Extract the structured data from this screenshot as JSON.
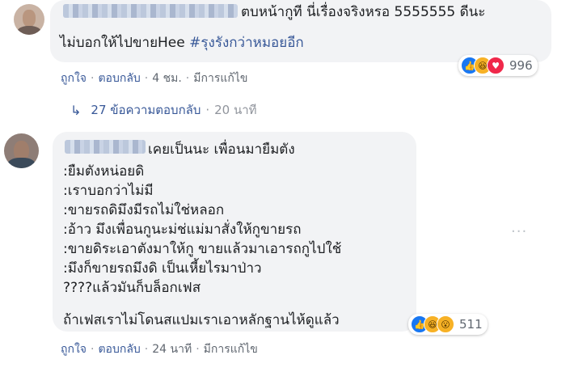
{
  "comments": [
    {
      "text_line1": "ตบหน้ากูที นี่เรื่องจริงหรอ 5555555 ดีนะ",
      "text_line2_plain": "ไม่บอกให้ไปขายHee ",
      "hashtag": "#รุงรังกว่าหมอยอีก",
      "reactions": {
        "count": "996",
        "icons": [
          "like-icon",
          "haha-icon",
          "love-icon"
        ]
      },
      "actions": {
        "like": "ถูกใจ",
        "reply": "ตอบกลับ",
        "time": "4 ชม.",
        "edited": "มีการแก้ไข"
      }
    },
    {
      "lines": [
        "เคยเป็นนะ เพื่อนมายืมตัง",
        ":ยืมตังหน่อยดิ",
        ":เราบอกว่าไม่มี",
        ":ขายรถดิมึงมีรถไม่ใช่หลอก",
        ":อ้าว มึงเพื่อนกูนะม่ช่แม่มาสั่งให้กูขายรถ",
        ":ขายดิระเอาตังมาให้กู ขายแล้วมาเอารถกูไปใช้",
        ":มึงก็ขายรถมึงดิ เป็นเหี้ยไรมาป่าว",
        "????แล้วมันก็บล็อกเฟส",
        "ถ้าเฟสเราไม่โดนสแปมเราเอาหลักฐานไห้ดูแล้ว"
      ],
      "reactions": {
        "count": "511",
        "icons": [
          "like-icon",
          "haha-icon",
          "wow-icon"
        ]
      },
      "actions": {
        "like": "ถูกใจ",
        "reply": "ตอบกลับ",
        "time": "24 นาที",
        "edited": "มีการแก้ไข"
      }
    }
  ],
  "replies_link": {
    "text": "27 ข้อความตอบกลับ",
    "time": "20 นาที"
  },
  "more_options": "···",
  "colors": {
    "link": "#385898",
    "bubble": "#f2f3f5",
    "meta": "#606770",
    "like": "#1877f2"
  }
}
